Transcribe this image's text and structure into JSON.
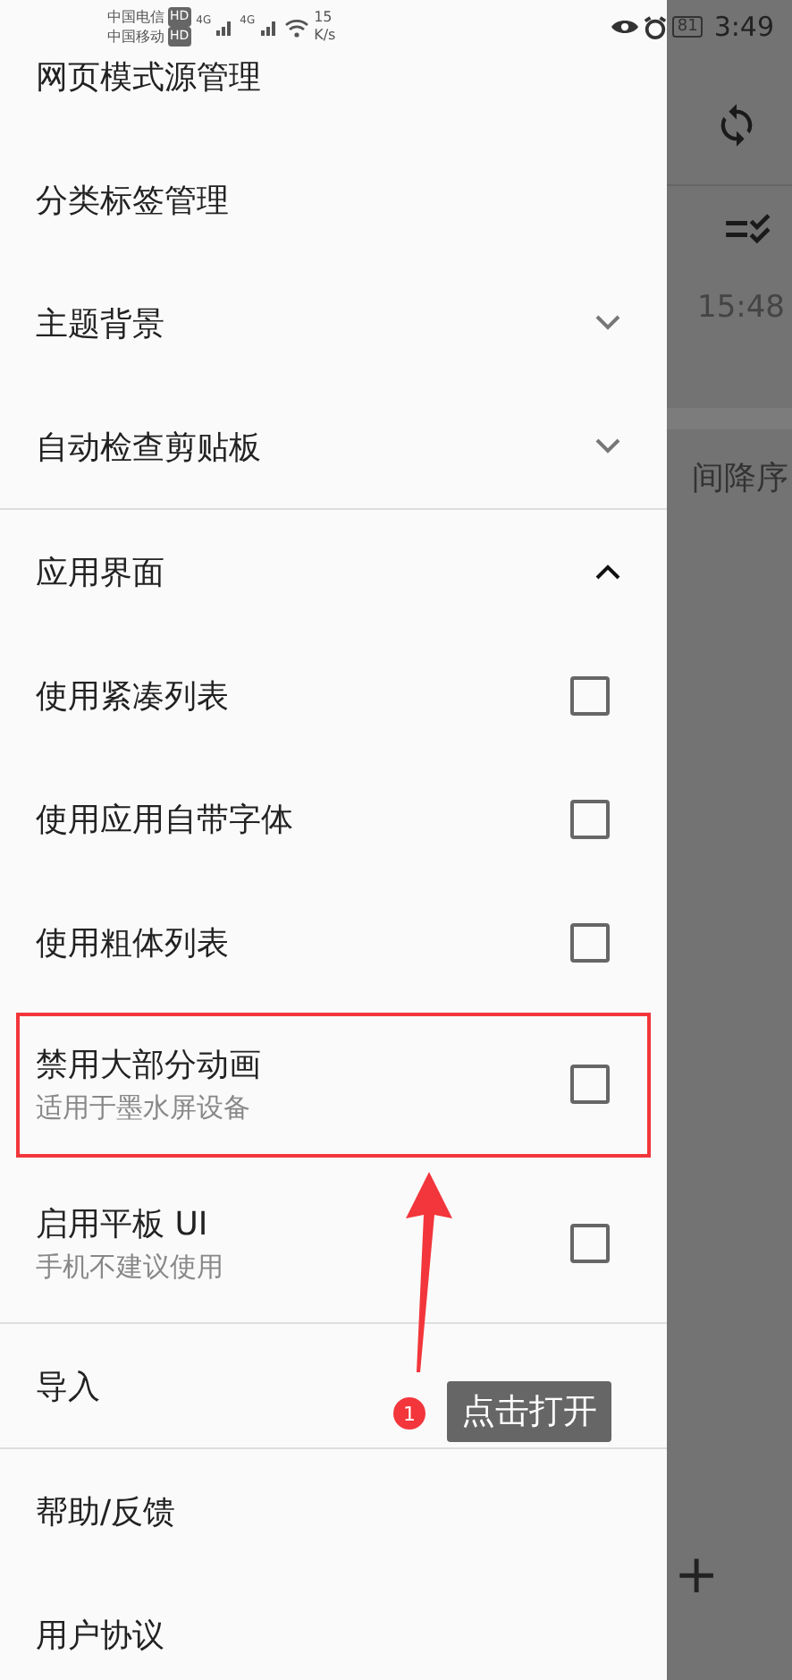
{
  "status_bar": {
    "carrier_1": "中国电信",
    "carrier_1_badge": "HD",
    "carrier_2": "中国移动",
    "carrier_2_badge": "HD",
    "signal_1": "4G",
    "signal_2": "4G",
    "speed": "15",
    "speed_unit": "K/s",
    "battery": "81",
    "time": "3:49"
  },
  "drawer": {
    "groups": [
      [
        {
          "kind": "link",
          "label": "网页模式源管理"
        },
        {
          "kind": "link",
          "label": "分类标签管理"
        },
        {
          "kind": "expand",
          "label": "主题背景",
          "expanded": false
        },
        {
          "kind": "expand",
          "label": "自动检查剪贴板",
          "expanded": false
        }
      ],
      [
        {
          "kind": "expand",
          "label": "应用界面",
          "expanded": true
        },
        {
          "kind": "checkbox",
          "label": "使用紧凑列表",
          "checked": false
        },
        {
          "kind": "checkbox",
          "label": "使用应用自带字体",
          "checked": false
        },
        {
          "kind": "checkbox",
          "label": "使用粗体列表",
          "checked": false
        },
        {
          "kind": "checkbox",
          "label": "禁用大部分动画",
          "subtitle": "适用于墨水屏设备",
          "checked": false,
          "highlighted": true
        },
        {
          "kind": "checkbox",
          "label": "启用平板 UI",
          "subtitle": "手机不建议使用",
          "checked": false
        }
      ],
      [
        {
          "kind": "link",
          "label": "导入"
        }
      ],
      [
        {
          "kind": "link",
          "label": "帮助/反馈"
        },
        {
          "kind": "link",
          "label": "用户协议"
        }
      ]
    ]
  },
  "background": {
    "time": "15:48",
    "sort_label": "间降序",
    "fab": "+"
  },
  "annotation": {
    "badge": "1",
    "tooltip": "点击打开"
  }
}
